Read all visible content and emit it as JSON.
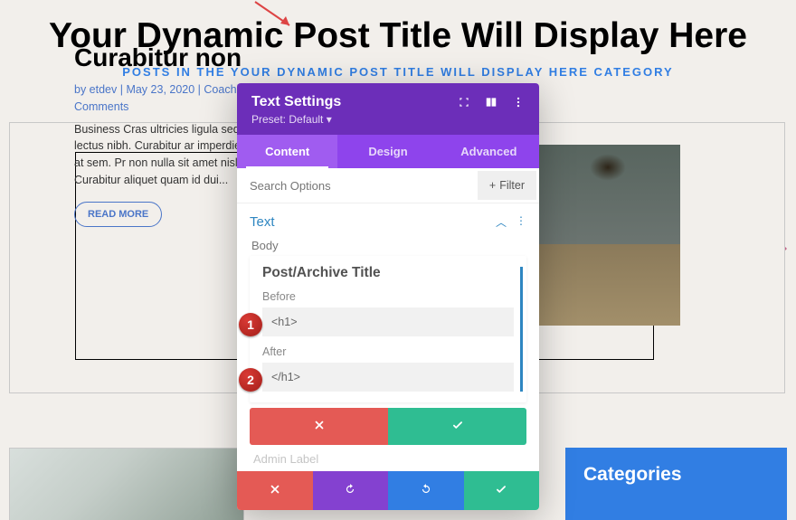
{
  "page": {
    "title": "Your Dynamic Post Title Will Display Here",
    "subtitle": "POSTS IN THE YOUR DYNAMIC POST TITLE WILL DISPLAY HERE CATEGORY"
  },
  "post": {
    "title": "Curabitur non",
    "meta": "by etdev | May 23, 2020 | Coaching Travel, | 0 Comments",
    "body": "Business Cras ultricies ligula sed porttitor lectus nibh. Curabitur ar imperdiet et, porttitor at sem. Pr non nulla sit amet nisl tempus co Curabitur aliquet quam id dui...",
    "read_more": "READ MORE"
  },
  "sidebar": {
    "categories_title": "Categories"
  },
  "panel": {
    "title": "Text Settings",
    "preset": "Preset: Default",
    "tabs": {
      "content": "Content",
      "design": "Design",
      "advanced": "Advanced"
    },
    "search_placeholder": "Search Options",
    "filter_label": "Filter",
    "section": "Text",
    "body_label": "Body",
    "dynamic": {
      "title": "Post/Archive Title",
      "before_label": "Before",
      "before_value": "<h1>",
      "after_label": "After",
      "after_value": "</h1>"
    },
    "badges": {
      "b1": "1",
      "b2": "2"
    },
    "admin_label": "Admin Label"
  }
}
